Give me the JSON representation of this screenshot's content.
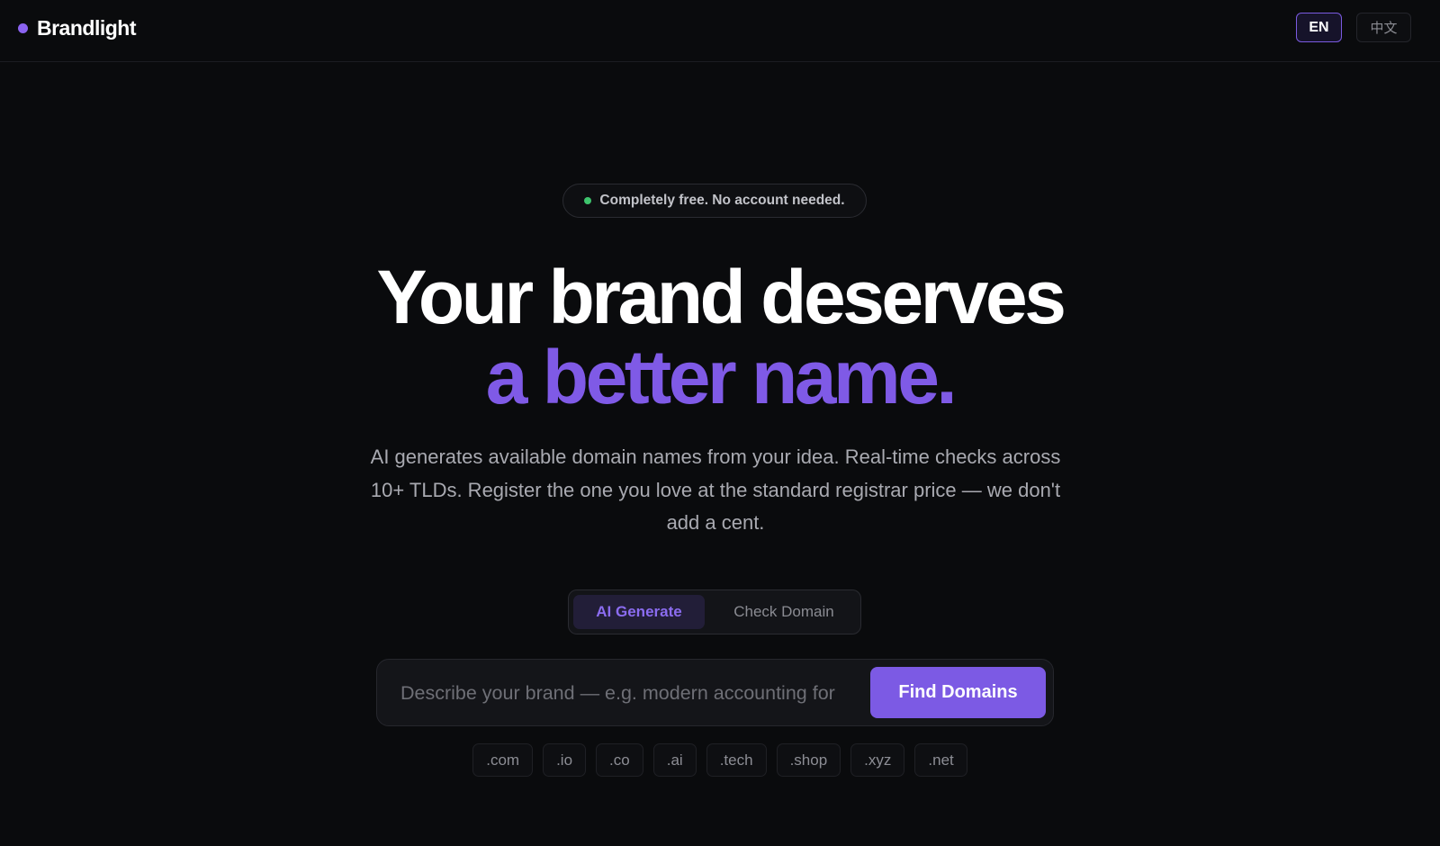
{
  "header": {
    "brand_name": "Brandlight",
    "lang_en": "EN",
    "lang_zh": "中文"
  },
  "hero": {
    "badge_text": "Completely free. No account needed.",
    "headline_line1": "Your brand deserves",
    "headline_line2": "a better name.",
    "subtitle": "AI generates available domain names from your idea. Real-time checks across 10+ TLDs. Register the one you love at the standard registrar price — we don't add a cent."
  },
  "tabs": [
    {
      "label": "AI Generate",
      "active": true
    },
    {
      "label": "Check Domain",
      "active": false
    }
  ],
  "search": {
    "placeholder": "Describe your brand — e.g. modern accounting for",
    "value": "",
    "button_label": "Find Domains"
  },
  "tlds": [
    ".com",
    ".io",
    ".co",
    ".ai",
    ".tech",
    ".shop",
    ".xyz",
    ".net"
  ],
  "colors": {
    "background": "#0a0b0d",
    "accent": "#7f5ae6",
    "status_green": "#3ec46d"
  }
}
